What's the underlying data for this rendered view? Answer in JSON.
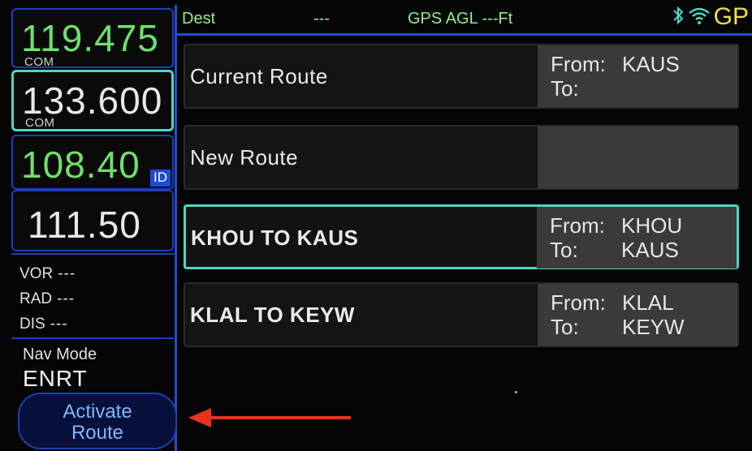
{
  "radios": {
    "com1": {
      "freq": "119.475",
      "sub": "COM"
    },
    "com2": {
      "freq": "133.600",
      "sub": "COM"
    },
    "nav1": {
      "freq": "108.40",
      "badge": "ID"
    },
    "nav2": {
      "freq": "111.50"
    }
  },
  "vor": {
    "items": [
      {
        "label": "VOR",
        "value": "---"
      },
      {
        "label": "RAD",
        "value": "---"
      },
      {
        "label": "DIS",
        "value": "---"
      }
    ]
  },
  "nav_mode": {
    "label": "Nav Mode",
    "value": "ENRT"
  },
  "activate": {
    "line1": "Activate",
    "line2": "Route"
  },
  "topbar": {
    "dest_label": "Dest",
    "dest_value": "---",
    "gps_agl": "GPS AGL ---Ft",
    "gps_text": "GP",
    "icons": [
      "bluetooth-icon",
      "wifi-icon"
    ]
  },
  "routes": [
    {
      "name": "Current Route",
      "from_label": "From:",
      "from": "KAUS",
      "to_label": "To:",
      "to": ""
    },
    {
      "name": "New Route",
      "from_label": "",
      "from": "",
      "to_label": "",
      "to": ""
    },
    {
      "name": "KHOU TO KAUS",
      "from_label": "From:",
      "from": "KHOU",
      "to_label": "To:",
      "to": "KAUS"
    },
    {
      "name": "KLAL TO KEYW",
      "from_label": "From:",
      "from": "KLAL",
      "to_label": "To:",
      "to": "KEYW"
    }
  ],
  "colors": {
    "accent_blue": "#1f4fd0",
    "selected_cyan": "#49d9c4",
    "freq_green": "#6fe06a",
    "gps_yellow": "#f0e040",
    "annotation_red": "#e8321e"
  }
}
